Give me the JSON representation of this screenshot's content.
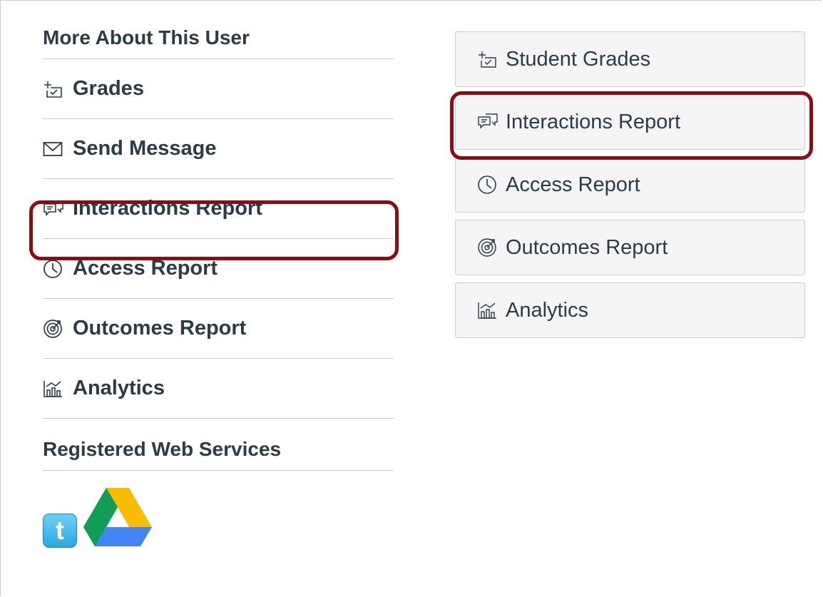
{
  "left": {
    "heading": "More About This User",
    "items": [
      {
        "label": "Grades",
        "icon": "grades-icon"
      },
      {
        "label": "Send Message",
        "icon": "mail-icon"
      },
      {
        "label": "Interactions Report",
        "icon": "interactions-icon"
      },
      {
        "label": "Access Report",
        "icon": "clock-icon"
      },
      {
        "label": "Outcomes Report",
        "icon": "outcomes-icon"
      },
      {
        "label": "Analytics",
        "icon": "analytics-icon"
      }
    ],
    "services_heading": "Registered Web Services",
    "services": [
      {
        "name": "twitter-logo",
        "glyph": "t"
      },
      {
        "name": "google-drive-logo"
      }
    ]
  },
  "right": {
    "buttons": [
      {
        "label": "Student Grades",
        "icon": "grades-icon"
      },
      {
        "label": "Interactions Report",
        "icon": "interactions-icon"
      },
      {
        "label": "Access Report",
        "icon": "clock-icon"
      },
      {
        "label": "Outcomes Report",
        "icon": "outcomes-icon"
      },
      {
        "label": "Analytics",
        "icon": "analytics-icon"
      }
    ]
  },
  "colors": {
    "highlight": "#8b0c14",
    "text": "#2d3b45",
    "border": "#c7cdd1",
    "button_bg": "#f5f5f5"
  }
}
